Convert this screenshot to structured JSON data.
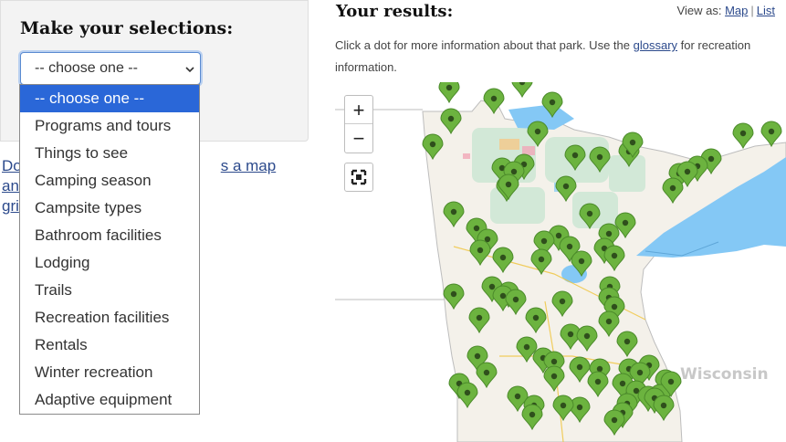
{
  "selections": {
    "title": "Make your selections:",
    "select_value": "-- choose one --",
    "options": [
      "-- choose one --",
      "Programs and tours",
      "Things to see",
      "Camping season",
      "Campsite types",
      "Bathroom facilities",
      "Lodging",
      "Trails",
      "Recreation facilities",
      "Rentals",
      "Winter recreation",
      "Adaptive equipment"
    ],
    "download_line1": "Do",
    "download_line1_end": "s a map and",
    "download_line2": "gri"
  },
  "results": {
    "title": "Your results:",
    "view_as": "View as:",
    "view_map": "Map",
    "view_sep": "|",
    "view_list": "List",
    "info_before": "Click a dot for more information about that park. Use the ",
    "info_link": "glossary",
    "info_after": " for recreation information."
  },
  "map": {
    "zoom_in": "+",
    "zoom_out": "−",
    "fullscreen_icon": "fullscreen-icon",
    "region_label": "Wisconsin",
    "marker_icon": "map-pin-icon",
    "colors": {
      "marker": "#6cb33f",
      "marker_outline": "#4b8a2a",
      "lake": "#84c8f5",
      "land": "#f4f1ea",
      "forest": "#cfe8d6"
    },
    "marker_count": 84
  }
}
